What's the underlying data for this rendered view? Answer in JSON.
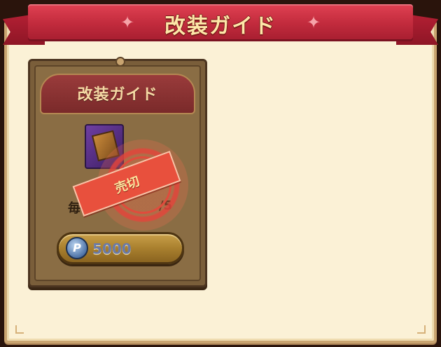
{
  "window": {
    "title": "改装ガイド"
  },
  "shop_item": {
    "title": "改装ガイド",
    "icon": "upgrade-guide-book-icon",
    "daily_limit_label": "毎日",
    "daily_limit_value": "/5",
    "price": "5000",
    "currency_icon": "p-coin-icon",
    "currency_symbol": "P",
    "status_stamp": "売切"
  },
  "colors": {
    "ribbon": "#c22b3d",
    "panel": "#fbf1d6",
    "card": "#7a5e3a",
    "stamp": "#e8503d",
    "price_button": "#a9802e"
  }
}
